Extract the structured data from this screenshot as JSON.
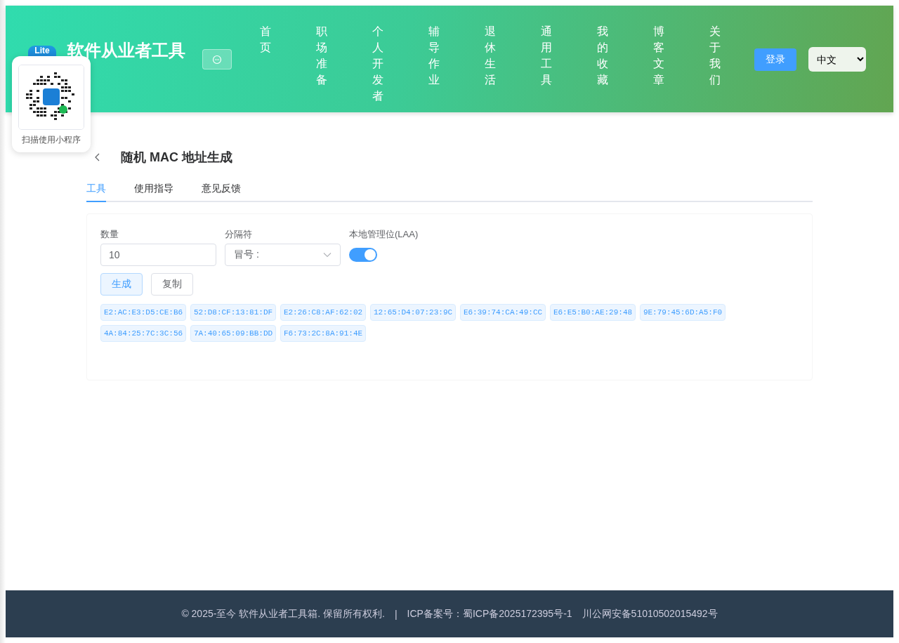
{
  "header": {
    "logo_text": "Lite",
    "title": "软件从业者工具",
    "nav": [
      "首页",
      "职场准备",
      "个人开发者",
      "辅导作业",
      "退休生活",
      "通用工具",
      "我的收藏",
      "博客文章",
      "关于我们"
    ],
    "login_button": "登录",
    "language_select": "中文"
  },
  "mini_program_popup": {
    "caption": "扫描使用小程序"
  },
  "page": {
    "title": "随机 MAC 地址生成",
    "tabs": [
      {
        "label": "工具",
        "selected": true
      },
      {
        "label": "使用指导",
        "selected": false
      },
      {
        "label": "意见反馈",
        "selected": false
      }
    ],
    "form": {
      "count": {
        "label": "数量",
        "value": "10"
      },
      "separator": {
        "label": "分隔符",
        "value": "冒号 :"
      },
      "laa": {
        "label": "本地管理位(LAA)",
        "on": true
      }
    },
    "buttons": [
      {
        "label": "生成",
        "kind": "primary"
      },
      {
        "label": "复制",
        "kind": "default"
      }
    ],
    "results": [
      "E2:AC:E3:D5:CE:B6",
      "52:D8:CF:13:81:DF",
      "E2:26:C8:AF:62:02",
      "12:65:D4:07:23:9C",
      "E6:39:74:CA:49:CC",
      "E6:E5:B0:AE:29:48",
      "9E:79:45:6D:A5:F0",
      "4A:84:25:7C:3C:56",
      "7A:40:65:09:BB:DD",
      "F6:73:2C:8A:91:4E"
    ]
  },
  "footer": {
    "copyright": "© 2025-至今 软件从业者工具箱. 保留所有权利.",
    "separator": "|",
    "icp": "ICP备案号：蜀ICP备2025172395号-1",
    "police": "川公网安备51010502015492号"
  }
}
